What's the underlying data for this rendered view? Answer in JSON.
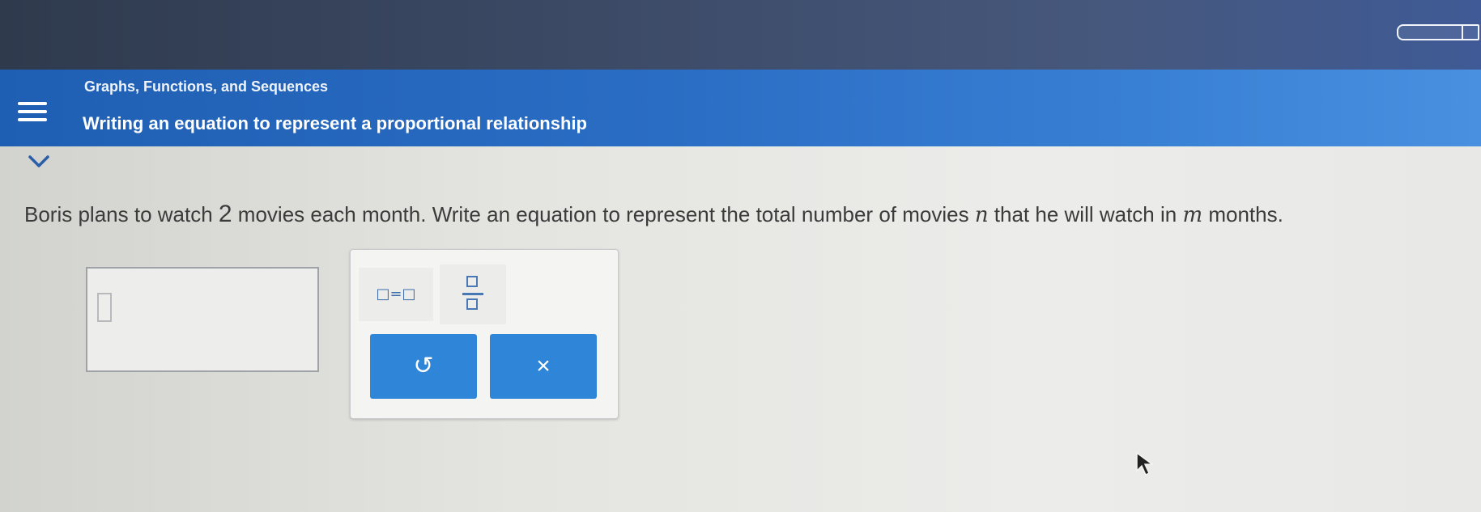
{
  "header": {
    "breadcrumb": "Graphs, Functions, and Sequences",
    "title": "Writing an equation to represent a proportional relationship",
    "accent_color": "#2a6dc4"
  },
  "icons": {
    "menu": "menu-icon",
    "collapse": "chevron-down-icon",
    "undo": "undo-icon",
    "clear": "close-icon",
    "cursor": "mouse-pointer-icon"
  },
  "question": {
    "part1": "Boris plans to watch ",
    "number": "2",
    "part2": " movies each month. Write an equation to represent the total number of movies ",
    "var_n": "n",
    "part3": " that he will watch in ",
    "var_m": "m",
    "part4": " months."
  },
  "answer": {
    "value": ""
  },
  "tools": {
    "equation_label": "□=□",
    "undo_symbol": "↺",
    "clear_symbol": "×"
  }
}
